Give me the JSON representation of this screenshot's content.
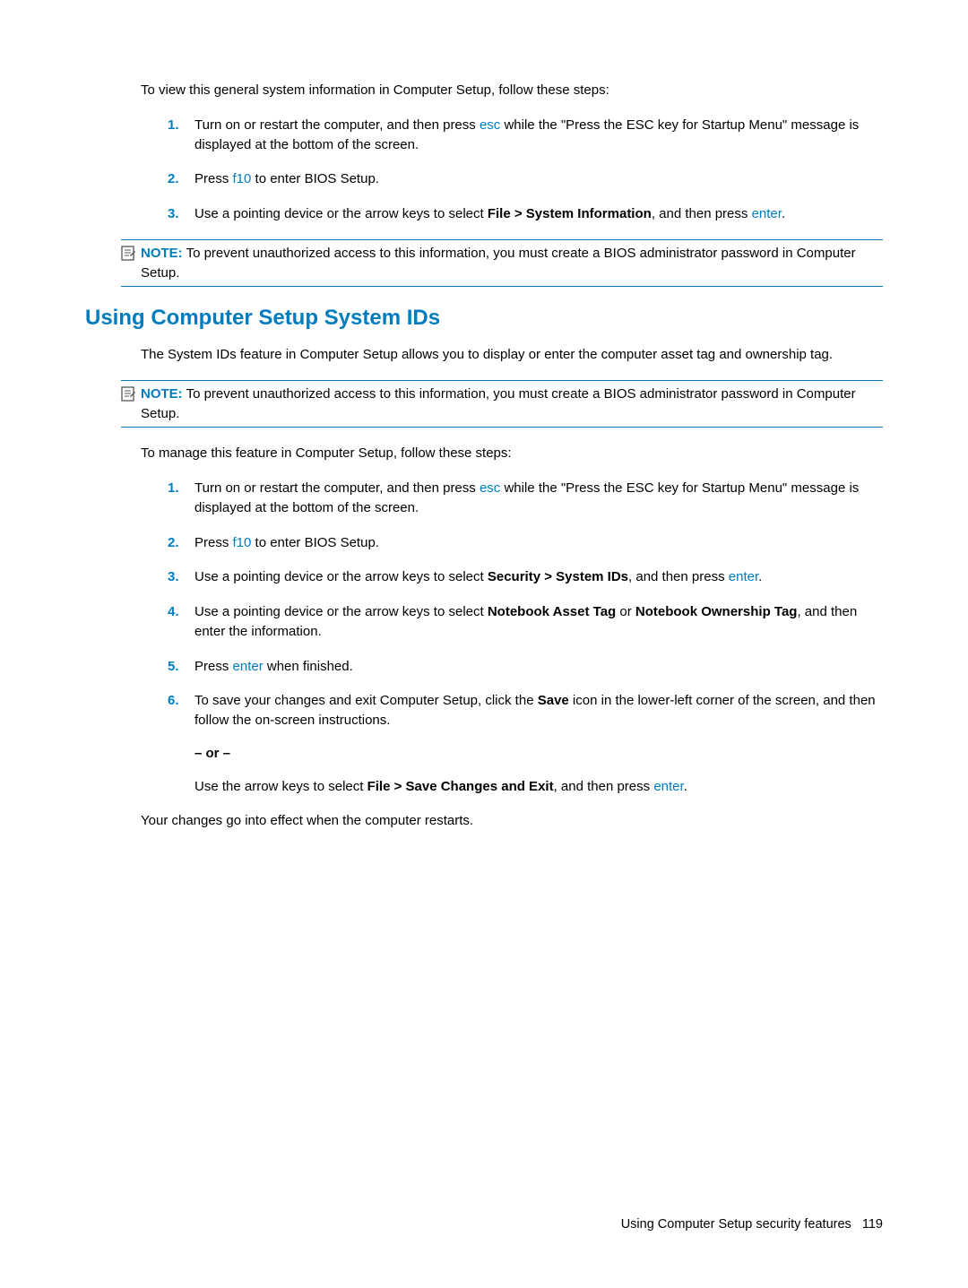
{
  "intro1": "To view this general system information in Computer Setup, follow these steps:",
  "list1": {
    "n1": "1.",
    "s1a": "Turn on or restart the computer, and then press ",
    "s1key": "esc",
    "s1b": " while the \"Press the ESC key for Startup Menu\" message is displayed at the bottom of the screen.",
    "n2": "2.",
    "s2a": "Press ",
    "s2key": "f10",
    "s2b": " to enter BIOS Setup.",
    "n3": "3.",
    "s3a": "Use a pointing device or the arrow keys to select ",
    "s3bold": "File > System Information",
    "s3b": ", and then press ",
    "s3key": "enter",
    "s3c": "."
  },
  "note1": {
    "label": "NOTE:",
    "text": "   To prevent unauthorized access to this information, you must create a BIOS administrator password in Computer Setup."
  },
  "h2": "Using Computer Setup System IDs",
  "intro2": "The System IDs feature in Computer Setup allows you to display or enter the computer asset tag and ownership tag.",
  "note2": {
    "label": "NOTE:",
    "text": "   To prevent unauthorized access to this information, you must create a BIOS administrator password in Computer Setup."
  },
  "intro3": "To manage this feature in Computer Setup, follow these steps:",
  "list2": {
    "n1": "1.",
    "s1a": "Turn on or restart the computer, and then press ",
    "s1key": "esc",
    "s1b": " while the \"Press the ESC key for Startup Menu\" message is displayed at the bottom of the screen.",
    "n2": "2.",
    "s2a": "Press ",
    "s2key": "f10",
    "s2b": " to enter BIOS Setup.",
    "n3": "3.",
    "s3a": "Use a pointing device or the arrow keys to select ",
    "s3bold": "Security > System IDs",
    "s3b": ", and then press ",
    "s3key": "enter",
    "s3c": ".",
    "n4": "4.",
    "s4a": "Use a pointing device or the arrow keys to select ",
    "s4bold1": "Notebook Asset Tag",
    "s4mid": " or ",
    "s4bold2": "Notebook Ownership Tag",
    "s4b": ", and then enter the information.",
    "n5": "5.",
    "s5a": "Press ",
    "s5key": "enter",
    "s5b": " when finished.",
    "n6": "6.",
    "s6a": "To save your changes and exit Computer Setup, click the ",
    "s6bold": "Save",
    "s6b": " icon in the lower-left corner of the screen, and then follow the on-screen instructions.",
    "or": "– or –",
    "s6c": "Use the arrow keys to select ",
    "s6bold2": "File > Save Changes and Exit",
    "s6d": ", and then press ",
    "s6key": "enter",
    "s6e": "."
  },
  "outro": "Your changes go into effect when the computer restarts.",
  "footer": {
    "text": "Using Computer Setup security features",
    "page": "119"
  }
}
